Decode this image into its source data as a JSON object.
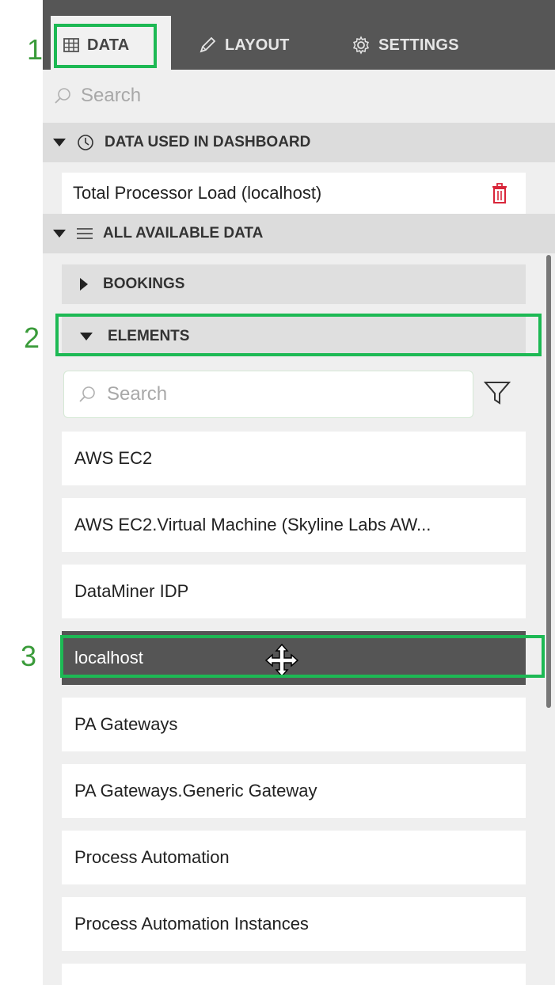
{
  "tabs": {
    "data": "DATA",
    "layout": "LAYOUT",
    "settings": "SETTINGS"
  },
  "search": {
    "placeholder": "Search"
  },
  "sections": {
    "used": {
      "title": "DATA USED IN DASHBOARD",
      "items": [
        "Total Processor Load (localhost)"
      ]
    },
    "all": {
      "title": "ALL AVAILABLE DATA",
      "groups": [
        "BOOKINGS",
        "ELEMENTS"
      ]
    }
  },
  "elements": {
    "search_placeholder": "Search",
    "items": [
      "AWS EC2",
      "AWS EC2.Virtual Machine (Skyline Labs AW...",
      "DataMiner IDP",
      "localhost",
      "PA Gateways",
      "PA Gateways.Generic Gateway",
      "Process Automation",
      "Process Automation Instances"
    ]
  },
  "annotations": [
    "1",
    "2",
    "3"
  ],
  "colors": {
    "highlight": "#1db954",
    "annotation_text": "#3a9b3a",
    "tabbar": "#565656",
    "selected_row": "#555555",
    "delete_icon": "#d9263a"
  },
  "icons": [
    "table-icon",
    "pencil-icon",
    "gear-icon",
    "search-icon",
    "history-icon",
    "list-icon",
    "trash-icon",
    "filter-icon",
    "move-cursor-icon"
  ]
}
